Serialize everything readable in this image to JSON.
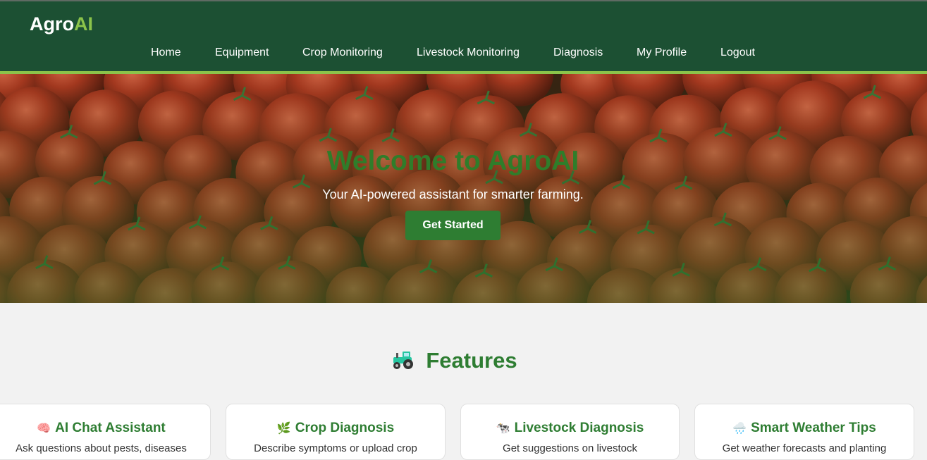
{
  "header": {
    "logo_primary": "Agro",
    "logo_accent": "AI",
    "nav": [
      "Home",
      "Equipment",
      "Crop Monitoring",
      "Livestock Monitoring",
      "Diagnosis",
      "My Profile",
      "Logout"
    ]
  },
  "hero": {
    "title": "Welcome to AgroAI",
    "subtitle": "Your AI-powered assistant for smarter farming.",
    "cta_label": "Get Started"
  },
  "features": {
    "title": "Features",
    "icon": "tractor-icon",
    "cards": [
      {
        "icon": "🧠",
        "icon_name": "brain-icon",
        "title": "AI Chat Assistant",
        "text": "Ask questions about pests, diseases"
      },
      {
        "icon": "🌿",
        "icon_name": "herb-icon",
        "title": "Crop Diagnosis",
        "text": "Describe symptoms or upload crop"
      },
      {
        "icon": "🐄",
        "icon_name": "cow-icon",
        "title": "Livestock Diagnosis",
        "text": "Get suggestions on livestock"
      },
      {
        "icon": "🌧️",
        "icon_name": "rain-cloud-icon",
        "title": "Smart Weather Tips",
        "text": "Get weather forecasts and planting"
      }
    ]
  },
  "colors": {
    "header_bg": "#1c5033",
    "accent": "#8bc34a",
    "brand_green": "#2e7d32",
    "page_bg": "#f2f2f2"
  }
}
